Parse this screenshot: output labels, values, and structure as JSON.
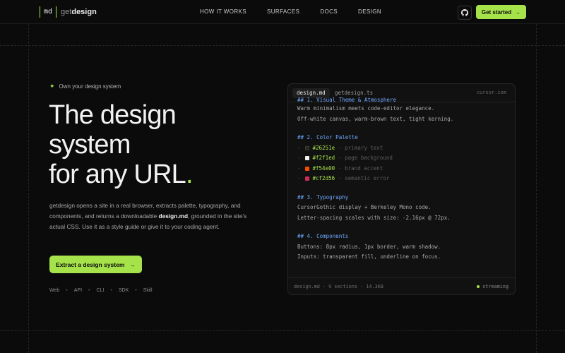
{
  "nav": {
    "logo_mark": "md",
    "logo_prefix": "get",
    "logo_suffix": "design",
    "links": [
      "HOW IT WORKS",
      "SURFACES",
      "DOCS",
      "DESIGN"
    ],
    "github_icon": "github-icon",
    "cta_label": "Get started"
  },
  "hero": {
    "eyebrow": "Own your design system",
    "headline_1": "The design",
    "headline_2": "system",
    "headline_3": "for any URL",
    "headline_dot": ".",
    "body_pre": "getdesign opens a site in a real browser, extracts palette, typography, and components, and returns a downloadable ",
    "body_bold": "design.md",
    "body_post": ", grounded in the site's actual CSS. Use it as a style guide or give it to your coding agent.",
    "cta_label": "Extract a design system",
    "surfaces": [
      "Web",
      "API",
      "CLI",
      "SDK",
      "Skill"
    ]
  },
  "panel": {
    "tabs": [
      "design.md",
      "getdesign.ts"
    ],
    "active_tab": "design.md",
    "domain": "cursor.com",
    "lines": {
      "h1": "## 1. Visual Theme & Atmosphere",
      "l1": "Warm minimalism meets code-editor elegance.",
      "l2": "Off-white canvas, warm-brown text, tight kerning.",
      "h2": "## 2. Color Palette",
      "h3": "## 3. Typography",
      "l3": "CursorGothic display + Berkeley Mono code.",
      "l4": "Letter-spacing scales with size: -2.16px @ 72px.",
      "h4": "## 4. Components",
      "l5": "Buttons: 8px radius, 1px border, warm shadow.",
      "l6": "Inputs: transparent fill, underline on focus."
    },
    "palette": [
      {
        "hex": "#26251e",
        "desc": "· primary text",
        "color": "#26251e"
      },
      {
        "hex": "#f2f1ed",
        "desc": "· page background",
        "color": "#f2f1ed"
      },
      {
        "hex": "#f54e00",
        "desc": "· brand accent",
        "color": "#f54e00"
      },
      {
        "hex": "#cf2d56",
        "desc": "· semantic error",
        "color": "#cf2d56"
      }
    ],
    "footer_meta": "design.md · 9 sections · 14.3KB",
    "status": "streaming"
  },
  "colors": {
    "accent": "#a6e34a",
    "background": "#0b0b0b",
    "heading_blue": "#6ea8ff"
  }
}
